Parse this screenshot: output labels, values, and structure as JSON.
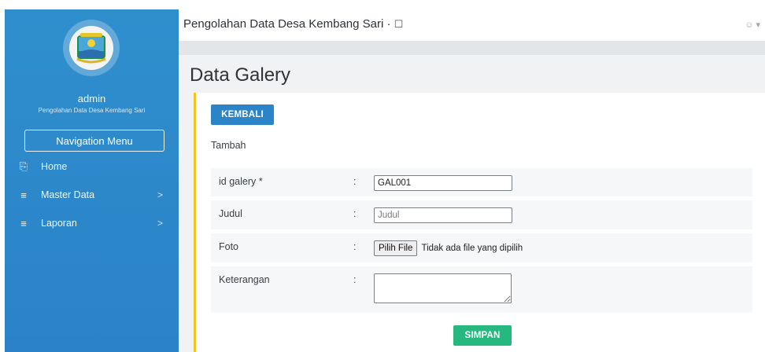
{
  "sidebar": {
    "user_name": "admin",
    "user_subtitle": "Pengolahan Data Desa Kembang Sari",
    "nav_button": "Navigation Menu",
    "items": [
      {
        "label": "Home",
        "icon": "document-icon"
      },
      {
        "label": "Master Data",
        "icon": "menu-icon",
        "arrow": ">"
      },
      {
        "label": "Laporan",
        "icon": "menu-icon",
        "arrow": ">"
      }
    ]
  },
  "topbar": {
    "title": "Pengolahan Data Desa Kembang Sari ·"
  },
  "page": {
    "title": "Data Galery",
    "back_button": "KEMBALI",
    "subtitle": "Tambah",
    "save_button": "SIMPAN"
  },
  "form": {
    "fields": [
      {
        "label": "id galery *",
        "colon": ":",
        "value": "GAL001"
      },
      {
        "label": "Judul",
        "colon": ":",
        "placeholder": "Judul"
      },
      {
        "label": "Foto",
        "colon": ":",
        "file_button": "Pilih File",
        "file_status": "Tidak ada file yang dipilih"
      },
      {
        "label": "Keterangan",
        "colon": ":"
      }
    ]
  },
  "colors": {
    "sidebar": "#2f8fcd",
    "primary": "#2b83c8",
    "success": "#27b87f",
    "accent": "#f2c521"
  }
}
